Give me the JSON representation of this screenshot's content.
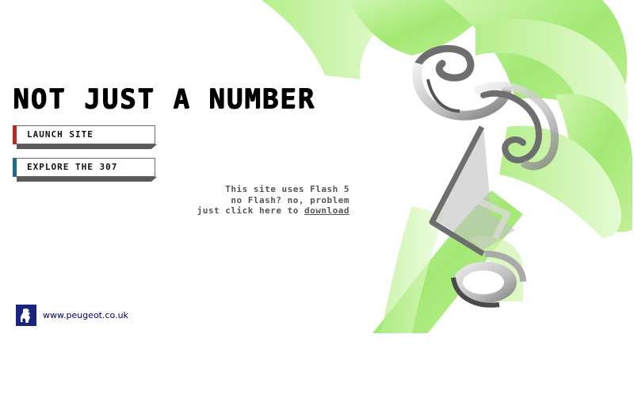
{
  "headline": "NOT JUST A NUMBER",
  "buttons": {
    "launch": {
      "label": "LAUNCH SITE",
      "accent_color": "#b72c1e"
    },
    "explore": {
      "label": "EXPLORE THE 307",
      "accent_color": "#1b6e8e"
    }
  },
  "flash_notice": {
    "line1": "This site uses Flash 5",
    "line2": "no Flash? no, problem",
    "line3_prefix": "just click here to ",
    "download_link": "download"
  },
  "footer": {
    "logo_icon": "peugeot-lion-icon",
    "url": "www.peugeot.co.uk"
  },
  "colors": {
    "ribbon_green": "#8fe05a",
    "numeral_grey": "#6e6e6e",
    "brand_blue": "#1a237e"
  }
}
